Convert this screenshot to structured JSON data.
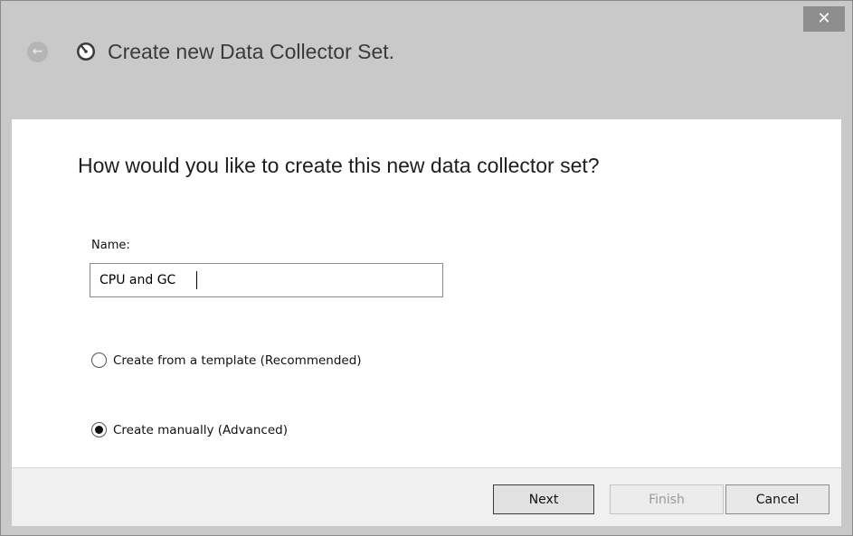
{
  "window": {
    "close_glyph": "✕",
    "title": "Create new Data Collector Set."
  },
  "header": {
    "back_icon": "back-arrow-icon",
    "app_icon": "performance-monitor-icon"
  },
  "content": {
    "question": "How would you like to create this new data collector set?",
    "name_label": "Name:",
    "name_value": "CPU and GC",
    "options": [
      {
        "label": "Create from a template (Recommended)",
        "checked": false
      },
      {
        "label": "Create manually (Advanced)",
        "checked": true
      }
    ]
  },
  "footer": {
    "next_label": "Next",
    "finish_label": "Finish",
    "cancel_label": "Cancel"
  },
  "colors": {
    "chrome": "#c9c9c9",
    "close_button": "#8e8e8e",
    "content_bg": "#ffffff",
    "footer_bg": "#f0f0f0",
    "disabled_text": "#9a9a9a"
  }
}
